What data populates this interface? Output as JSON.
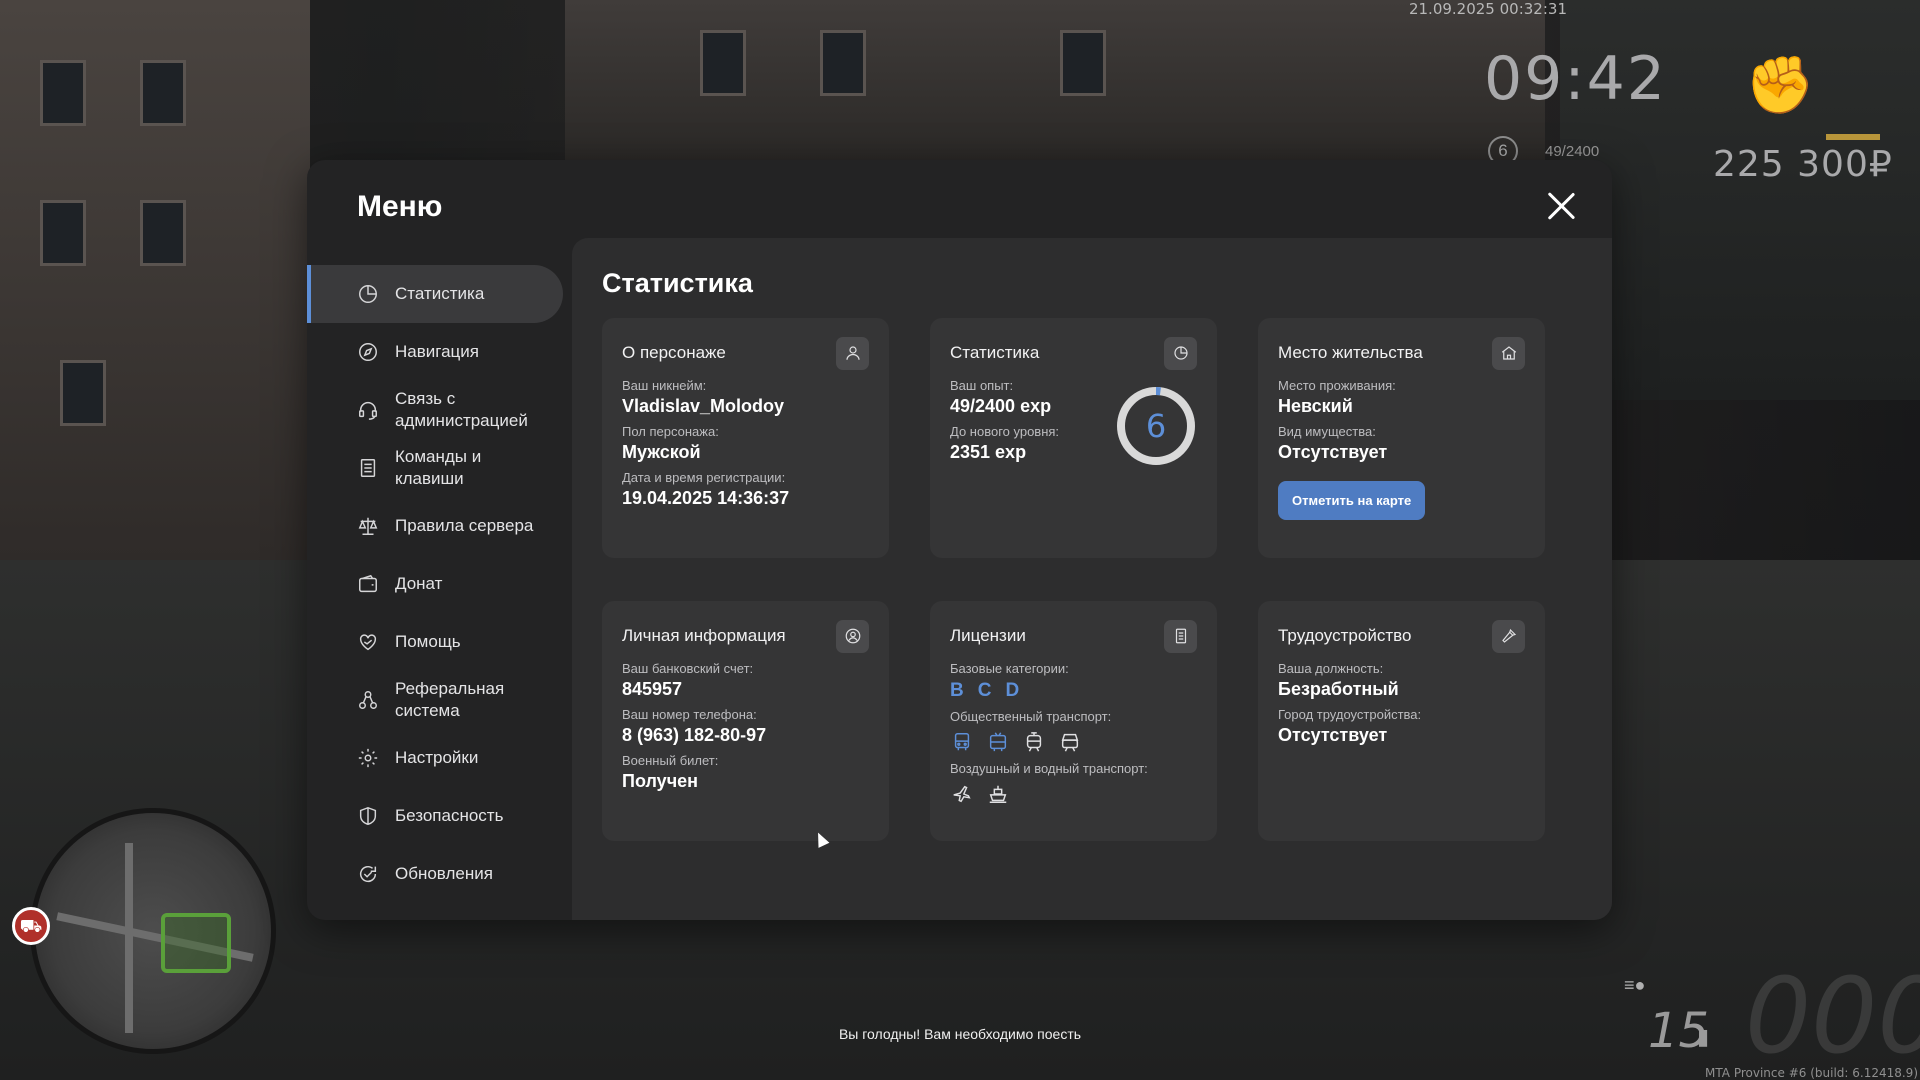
{
  "hud": {
    "datetime": "21.09.2025 00:32:31",
    "clock": "09:42",
    "level": "6",
    "exp": "49/2400",
    "money": "225 300₽",
    "speed": "15",
    "speed_ghost": "000",
    "build": "MTA Province #6 (build: 6.12418.9)",
    "hunger_message": "Вы голодны! Вам необходимо поесть"
  },
  "menu": {
    "title": "Меню",
    "items": [
      {
        "label": "Статистика",
        "icon": "pie-chart-icon"
      },
      {
        "label": "Навигация",
        "icon": "compass-icon"
      },
      {
        "label": "Связь с администрацией",
        "icon": "headset-icon"
      },
      {
        "label": "Команды и клавиши",
        "icon": "document-list-icon"
      },
      {
        "label": "Правила сервера",
        "icon": "scales-icon"
      },
      {
        "label": "Донат",
        "icon": "wallet-icon"
      },
      {
        "label": "Помощь",
        "icon": "heart-hand-icon"
      },
      {
        "label": "Реферальная система",
        "icon": "network-icon"
      },
      {
        "label": "Настройки",
        "icon": "gear-icon"
      },
      {
        "label": "Безопасность",
        "icon": "shield-icon"
      },
      {
        "label": "Обновления",
        "icon": "refresh-check-icon"
      }
    ],
    "active_index": 0
  },
  "content": {
    "title": "Статистика",
    "character": {
      "title": "О персонаже",
      "nickname_label": "Ваш никнейм:",
      "nickname": "Vladislav_Molodoy",
      "gender_label": "Пол персонажа:",
      "gender": "Мужской",
      "reg_label": "Дата и время регистрации:",
      "reg_date": "19.04.2025 14:36:37"
    },
    "stats": {
      "title": "Статистика",
      "exp_label": "Ваш опыт:",
      "exp": "49/2400 exp",
      "next_label": "До нового уровня:",
      "next": "2351 exp",
      "level": "6",
      "progress": 0.0204
    },
    "residence": {
      "title": "Место жительства",
      "place_label": "Место проживания:",
      "place": "Невский",
      "property_label": "Вид имущества:",
      "property": "Отсутствует",
      "map_button": "Отметить на карте"
    },
    "personal": {
      "title": "Личная информация",
      "bank_label": "Ваш банковский счет:",
      "bank": "845957",
      "phone_label": "Ваш номер телефона:",
      "phone": "8 (963) 182-80-97",
      "military_label": "Военный билет:",
      "military": "Получен"
    },
    "licenses": {
      "title": "Лицензии",
      "base_label": "Базовые категории:",
      "categories": [
        "B",
        "C",
        "D"
      ],
      "public_label": "Общественный транспорт:",
      "public_icons": [
        "bus-icon",
        "trolleybus-icon",
        "tram-icon",
        "train-icon"
      ],
      "air_label": "Воздушный и водный транспорт:",
      "air_icons": [
        "airplane-icon",
        "ship-icon"
      ]
    },
    "job": {
      "title": "Трудоустройство",
      "position_label": "Ваша должность:",
      "position": "Безработный",
      "city_label": "Город трудоустройства:",
      "city": "Отсутствует"
    }
  },
  "colors": {
    "accent": "#5d8fd8",
    "button": "#4f7cc2",
    "panel": "#232324",
    "card": "#353536"
  }
}
